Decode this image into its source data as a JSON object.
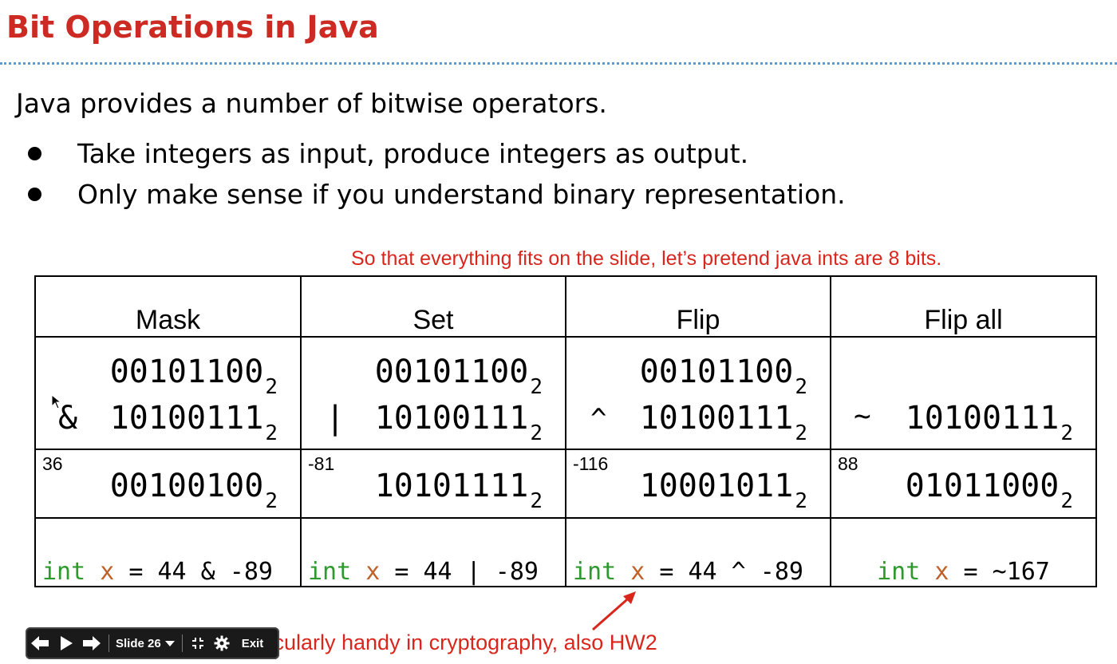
{
  "slide": {
    "title": "Bit Operations in Java",
    "intro": "Java provides a number of bitwise operators.",
    "bullets": [
      "Take integers as input, produce integers as output.",
      "Only make sense if you understand binary representation."
    ],
    "note": "So that everything fits on the slide, let’s pretend java ints are 8 bits.",
    "bottom_note": "rticularly handy in cryptography, also HW2"
  },
  "table": {
    "columns": [
      {
        "header": "Mask",
        "operand1": "00101100",
        "operator": "&",
        "operand2": "10100111",
        "result_label": "36",
        "result": "00100100",
        "code": {
          "kw": "int",
          "var": "x",
          "rest": " = 44 & -89"
        }
      },
      {
        "header": "Set",
        "operand1": "00101100",
        "operator": "|",
        "operand2": "10100111",
        "result_label": "-81",
        "result": "10101111",
        "code": {
          "kw": "int",
          "var": "x",
          "rest": " = 44 | -89"
        }
      },
      {
        "header": "Flip",
        "operand1": "00101100",
        "operator": "^",
        "operand2": "10100111",
        "result_label": "-116",
        "result": "10001011",
        "code": {
          "kw": "int",
          "var": "x",
          "rest": " = 44 ^ -89"
        }
      },
      {
        "header": "Flip all",
        "operand1": "",
        "operator": "~",
        "operand2": "10100111",
        "result_label": "88",
        "result": "01011000",
        "code": {
          "kw": "int",
          "var": "x",
          "rest": " = ~167"
        }
      }
    ],
    "base_subscript": "2"
  },
  "toolbar": {
    "prev_icon": "arrow-left-icon",
    "play_icon": "play-icon",
    "next_icon": "arrow-right-icon",
    "slide_label": "Slide 26",
    "fullscreen_icon": "collapse-fullscreen-icon",
    "settings_icon": "gear-icon",
    "exit_label": "Exit"
  },
  "colors": {
    "title": "#cc2a22",
    "note": "#d9261c",
    "keyword": "#2e9a2e",
    "variable": "#c0612a",
    "divider": "#5b9bd5",
    "toolbar_bg": "#1a1a1a"
  }
}
